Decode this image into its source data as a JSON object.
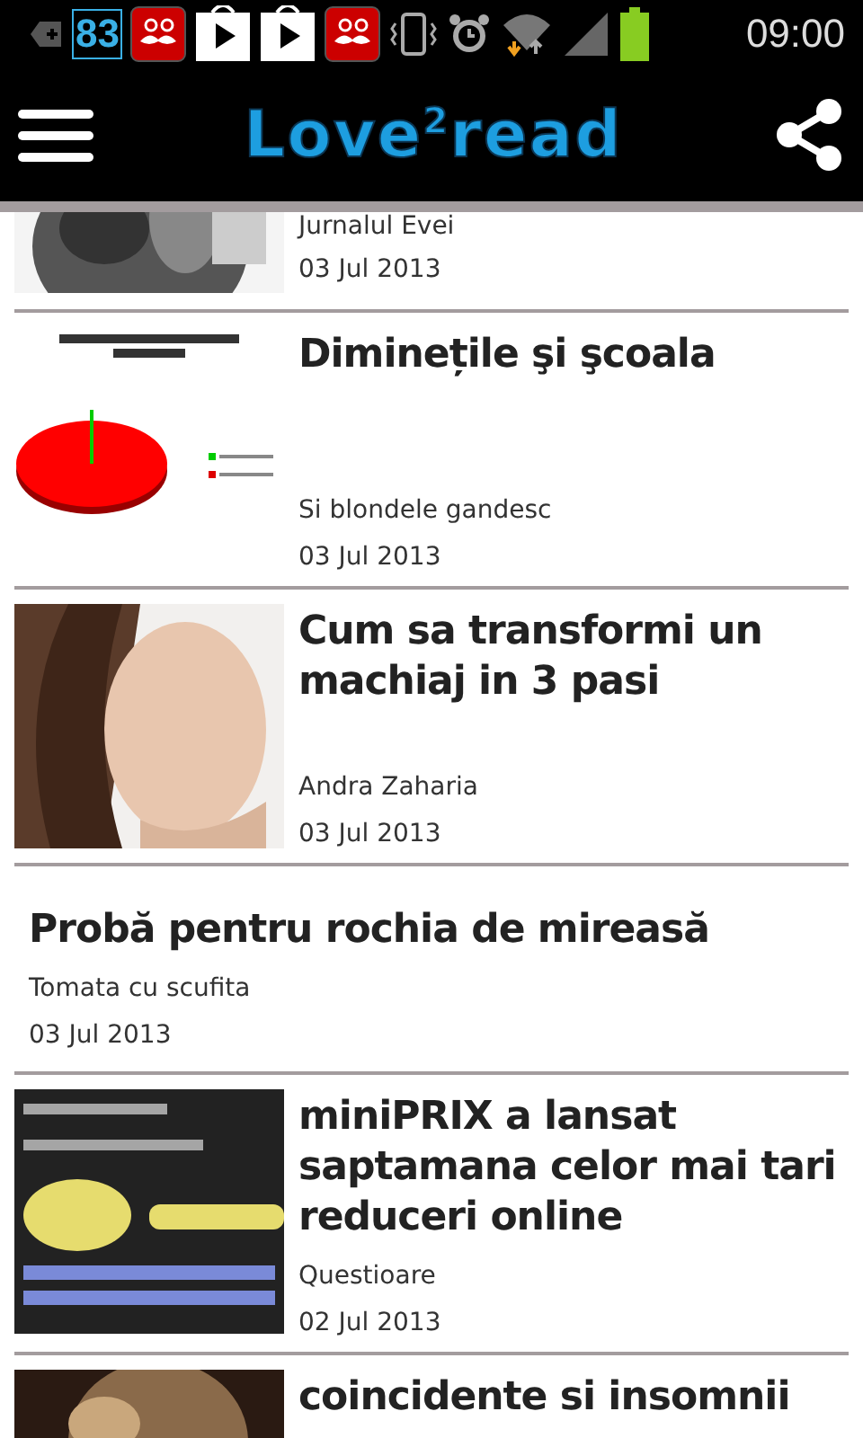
{
  "status_bar": {
    "badge": "83",
    "time": "09:00"
  },
  "app_bar": {
    "logo": "Love$^{2}$read"
  },
  "articles": [
    {
      "kind": "with-image",
      "author": "Jurnalul Evei",
      "date": "03 Jul 2013"
    },
    {
      "kind": "with-image",
      "title": "Diminețile şi şcoala",
      "author": "Si blondele gandesc",
      "date": "03 Jul 2013"
    },
    {
      "kind": "with-image",
      "title": "Cum sa transformi un machiaj in 3 pasi",
      "author": "Andra Zaharia",
      "date": "03 Jul 2013"
    },
    {
      "kind": "text-only",
      "title": "Probă pentru rochia de mireasă",
      "author": "Tomata cu scufita",
      "date": "03 Jul 2013"
    },
    {
      "kind": "with-image",
      "title": "miniPRIX a lansat saptamana celor mai tari reduceri online",
      "author": "Questioare",
      "date": "02 Jul 2013"
    },
    {
      "kind": "with-image",
      "title": "coincidente si insomnii"
    }
  ]
}
